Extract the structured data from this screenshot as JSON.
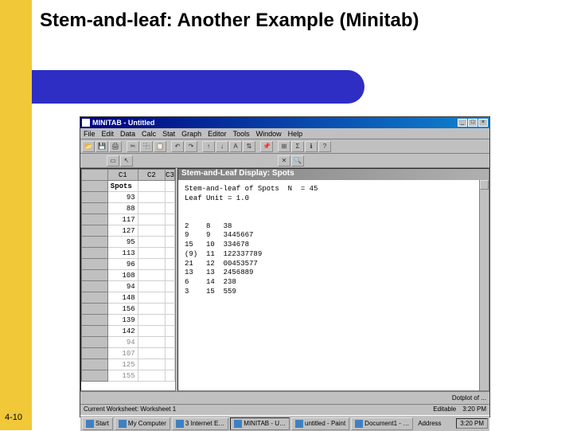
{
  "slide": {
    "title": "Stem-and-leaf: Another Example (Minitab)",
    "page": "4-10"
  },
  "window": {
    "title": "MINITAB - Untitled",
    "menus": [
      "File",
      "Edit",
      "Data",
      "Calc",
      "Stat",
      "Graph",
      "Editor",
      "Tools",
      "Window",
      "Help"
    ],
    "session_title": "Stem-and-Leaf Display: Spots",
    "session_text": "Stem-and-leaf of Spots  N  = 45\nLeaf Unit = 1.0\n\n\n2    8   38\n9    9   3445667\n15   10  334678\n(9)  11  122337789\n21   12  00453577\n13   13  2456889\n6    14  238\n3    15  559",
    "worksheet": {
      "cols": [
        "C1",
        "C2",
        "C3"
      ],
      "name": "Spots",
      "rows": [
        "93",
        "88",
        "117",
        "127",
        "95",
        "113",
        "96",
        "108",
        "94",
        "148",
        "156",
        "139",
        "142",
        "94",
        "107",
        "125",
        "155"
      ]
    },
    "status": "Current Worksheet: Worksheet 1",
    "bottom_label": "Dotplot of ...",
    "editable": "Editable",
    "time_status": "3:20 PM"
  },
  "taskbar": {
    "start": "Start",
    "items": [
      "My Computer",
      "3 Internet E…",
      "MINITAB - U…",
      "untitled - Paint",
      "Document1 - …"
    ],
    "address": "Address",
    "clock": "3:20 PM"
  }
}
